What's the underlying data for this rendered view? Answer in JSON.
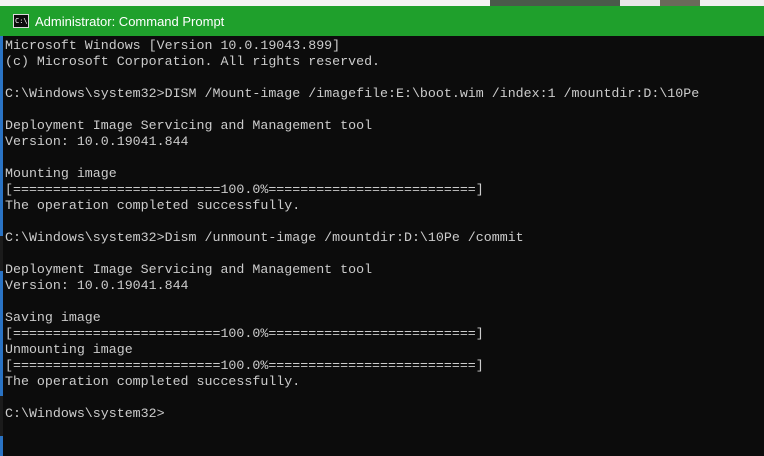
{
  "window": {
    "title": "Administrator: Command Prompt",
    "icon": "cmd-console-icon",
    "icon_glyph": "C:\\",
    "titlebar_color": "#1fa02c",
    "text_color": "#cccccc",
    "background_color": "#0c0c0c"
  },
  "console": {
    "lines": [
      "Microsoft Windows [Version 10.0.19043.899]",
      "(c) Microsoft Corporation. All rights reserved.",
      "",
      "C:\\Windows\\system32>DISM /Mount-image /imagefile:E:\\boot.wim /index:1 /mountdir:D:\\10Pe",
      "",
      "Deployment Image Servicing and Management tool",
      "Version: 10.0.19041.844",
      "",
      "Mounting image",
      "[==========================100.0%==========================]",
      "The operation completed successfully.",
      "",
      "C:\\Windows\\system32>Dism /unmount-image /mountdir:D:\\10Pe /commit",
      "",
      "Deployment Image Servicing and Management tool",
      "Version: 10.0.19041.844",
      "",
      "Saving image",
      "[==========================100.0%==========================]",
      "Unmounting image",
      "[==========================100.0%==========================]",
      "The operation completed successfully.",
      "",
      "C:\\Windows\\system32>"
    ]
  }
}
